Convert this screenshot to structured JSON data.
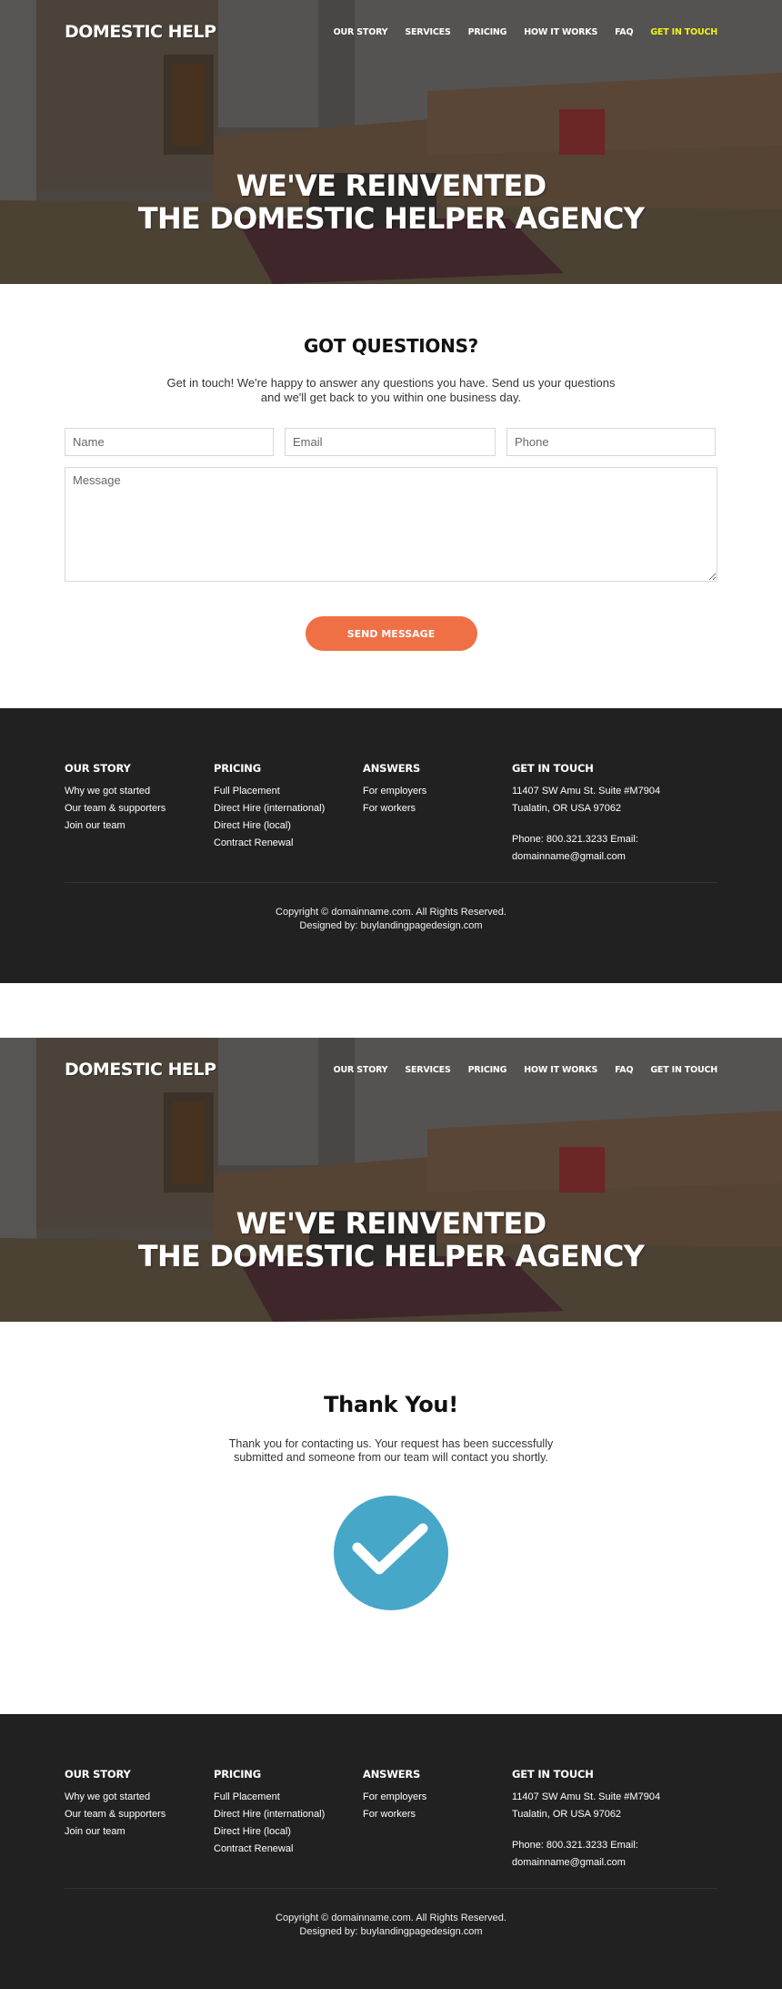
{
  "colors": {
    "accent_button": "#f07045",
    "nav_active": "#f3f319",
    "footer_bg": "#212121",
    "success_circle": "#46a7c8"
  },
  "page1": {
    "header": {
      "logo": "DOMESTIC HELP",
      "nav": [
        {
          "label": "OUR STORY",
          "active": false
        },
        {
          "label": "SERVICES",
          "active": false
        },
        {
          "label": "PRICING",
          "active": false
        },
        {
          "label": "HOW IT WORKS",
          "active": false
        },
        {
          "label": "FAQ",
          "active": false
        },
        {
          "label": "GET IN TOUCH",
          "active": true
        }
      ]
    },
    "hero": {
      "title_line1": "WE'VE REINVENTED",
      "title_line2": "THE DOMESTIC HELPER AGENCY"
    },
    "contact": {
      "title": "GOT QUESTIONS?",
      "text": "Get in touch! We're happy to answer any questions you have. Send us your questions and we'll get back to you within one business day.",
      "fields": {
        "name_placeholder": "Name",
        "email_placeholder": "Email",
        "phone_placeholder": "Phone",
        "message_placeholder": "Message"
      },
      "submit_label": "SEND MESSAGE"
    }
  },
  "page2": {
    "header": {
      "logo": "DOMESTIC HELP",
      "nav": [
        {
          "label": "OUR STORY"
        },
        {
          "label": "SERVICES"
        },
        {
          "label": "PRICING"
        },
        {
          "label": "HOW IT WORKS"
        },
        {
          "label": "FAQ"
        },
        {
          "label": "GET IN TOUCH"
        }
      ]
    },
    "hero": {
      "title_line1": "WE'VE REINVENTED",
      "title_line2": "THE DOMESTIC HELPER AGENCY"
    },
    "thanks": {
      "title": "Thank You!",
      "text": "Thank you for contacting us. Your request has been successfully submitted and someone from our team will contact you shortly.",
      "icon": "checkmark-circle-icon"
    }
  },
  "footer": {
    "columns": [
      {
        "heading": "OUR STORY",
        "links": [
          "Why we got started",
          "Our team & supporters",
          "Join our team"
        ]
      },
      {
        "heading": "PRICING",
        "links": [
          "Full Placement",
          "Direct Hire (international)",
          "Direct Hire (local)",
          "Contract Renewal"
        ]
      },
      {
        "heading": "ANSWERS",
        "links": [
          "For employers",
          "For workers"
        ]
      }
    ],
    "contact": {
      "heading": "GET IN TOUCH",
      "address_line1": "11407 SW Amu St. Suite #M7904",
      "address_line2": "Tualatin, OR USA 97062",
      "phone_email_line1": "Phone: 800.321.3233 Email:",
      "phone_email_line2": "domainname@gmail.com"
    },
    "copyright": "Copyright © domainname.com. All Rights Reserved.",
    "designed_by": "Designed by: buylandingpagedesign.com"
  }
}
